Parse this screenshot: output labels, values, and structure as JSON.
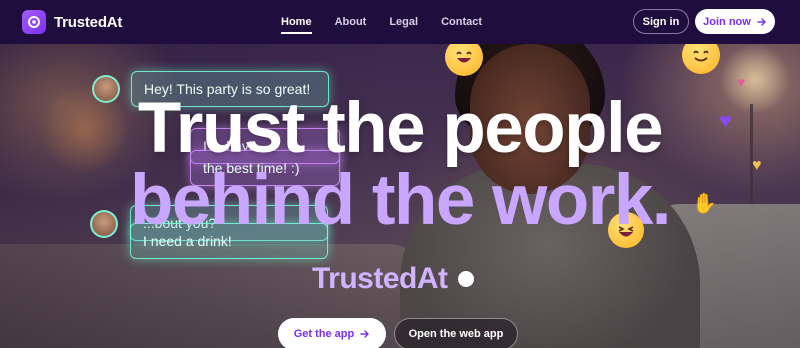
{
  "brand": {
    "name": "TrustedAt",
    "accent": "#7b2ff0",
    "highlight": "#c9a6ff"
  },
  "nav": {
    "links": [
      {
        "label": "Home",
        "active": true
      },
      {
        "label": "About",
        "active": false
      },
      {
        "label": "Legal",
        "active": false
      },
      {
        "label": "Contact",
        "active": false
      }
    ],
    "signin_label": "Sign in",
    "join_label": "Join now",
    "join_icon": "arrow-right-icon"
  },
  "hero": {
    "headline_line1": "Trust the people",
    "headline_line2": "behind the work.",
    "brand_wordmark": "TrustedAt",
    "chat_bubbles": [
      {
        "text": "Hey! This party is so great!"
      },
      {
        "text": "I ... havi"
      },
      {
        "text": "the best time! :)"
      },
      {
        "text": "...bout you?"
      },
      {
        "text": "I need a drink!"
      }
    ],
    "cta_primary_label": "Get the app",
    "cta_primary_icon": "arrow-right-icon",
    "cta_secondary_label": "Open the web app"
  }
}
